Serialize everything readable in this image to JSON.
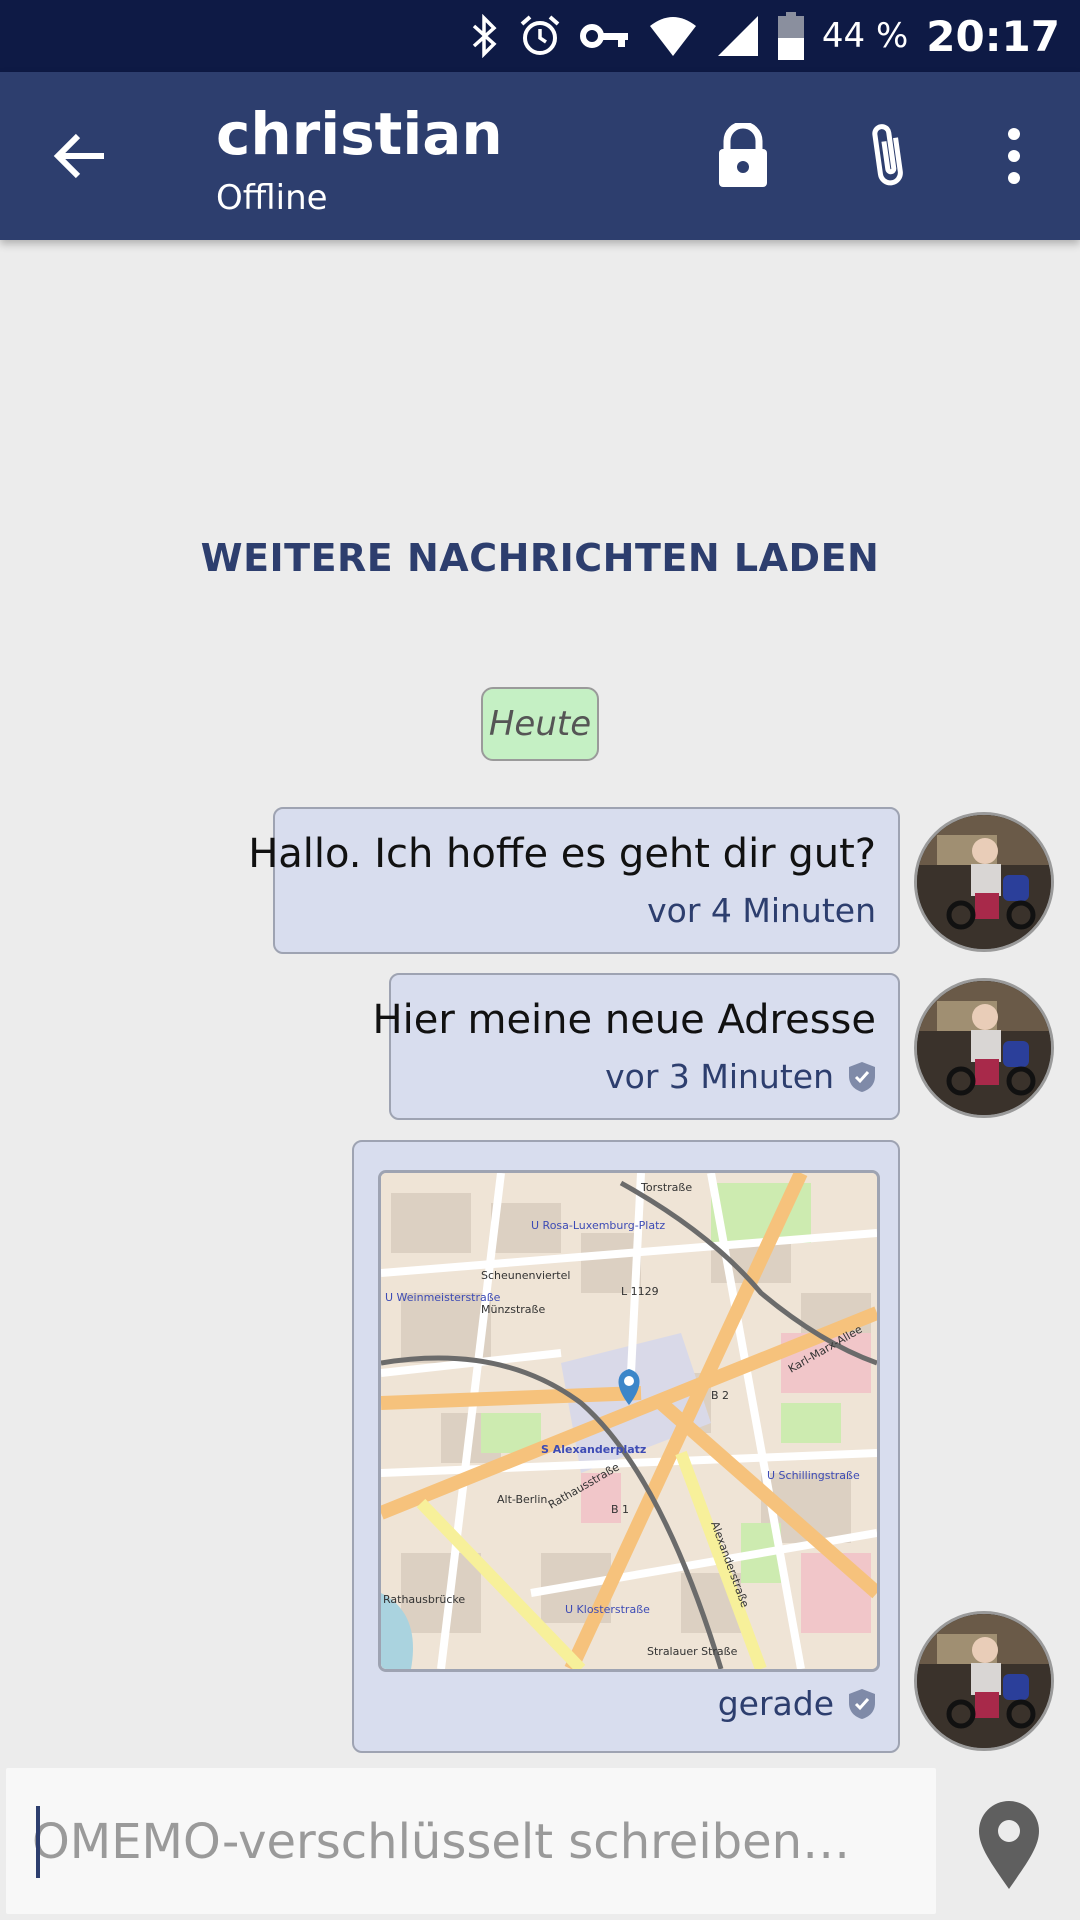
{
  "status_bar": {
    "battery": "44 %",
    "time": "20:17",
    "icons": [
      "bluetooth-icon",
      "alarm-icon",
      "vpn-key-icon",
      "wifi-icon",
      "signal-icon",
      "battery-icon"
    ]
  },
  "header": {
    "title": "christian",
    "subtitle": "Offline",
    "actions": [
      "lock-icon",
      "attach-icon",
      "more-vert-icon"
    ]
  },
  "conversation": {
    "load_more": "WEITERE NACHRICHTEN LADEN",
    "date_chip": "Heute",
    "messages": [
      {
        "text": "Hallo. Ich hoffe es geht dir gut?",
        "time": "vor 4 Minuten",
        "verified": false
      },
      {
        "text": "Hier meine neue Adresse",
        "time": "vor 3 Minuten",
        "verified": true
      },
      {
        "type": "location-map",
        "time": "gerade",
        "verified": true
      }
    ]
  },
  "map_labels": {
    "l1": "Torstraße",
    "l2": "U Rosa-Luxemburg-Platz",
    "l3": "Scheunenviertel",
    "l4": "U Weinmeisterstraße",
    "l5": "Münzstraße",
    "l6": "L 1129",
    "l7": "B 2",
    "l8": "S Alexanderplatz",
    "l9": "Alt-Berlin",
    "l10": "U Schillingstraße",
    "l11": "B 1",
    "l12": "U Klosterstraße",
    "l13": "Rathausbrücke",
    "l14": "Alexanderstraße",
    "l15": "Stralauer Straße",
    "l16": "Rathausstraße",
    "l17": "Karl-Marx-Allee"
  },
  "compose": {
    "placeholder": "OMEMO-verschlüsselt schreiben…"
  },
  "colors": {
    "status_bar": "#0e1a45",
    "app_bar": "#2d3e6e",
    "bubble": "#d8ddee",
    "date_chip": "#c5f0c4",
    "background": "#ececec"
  }
}
